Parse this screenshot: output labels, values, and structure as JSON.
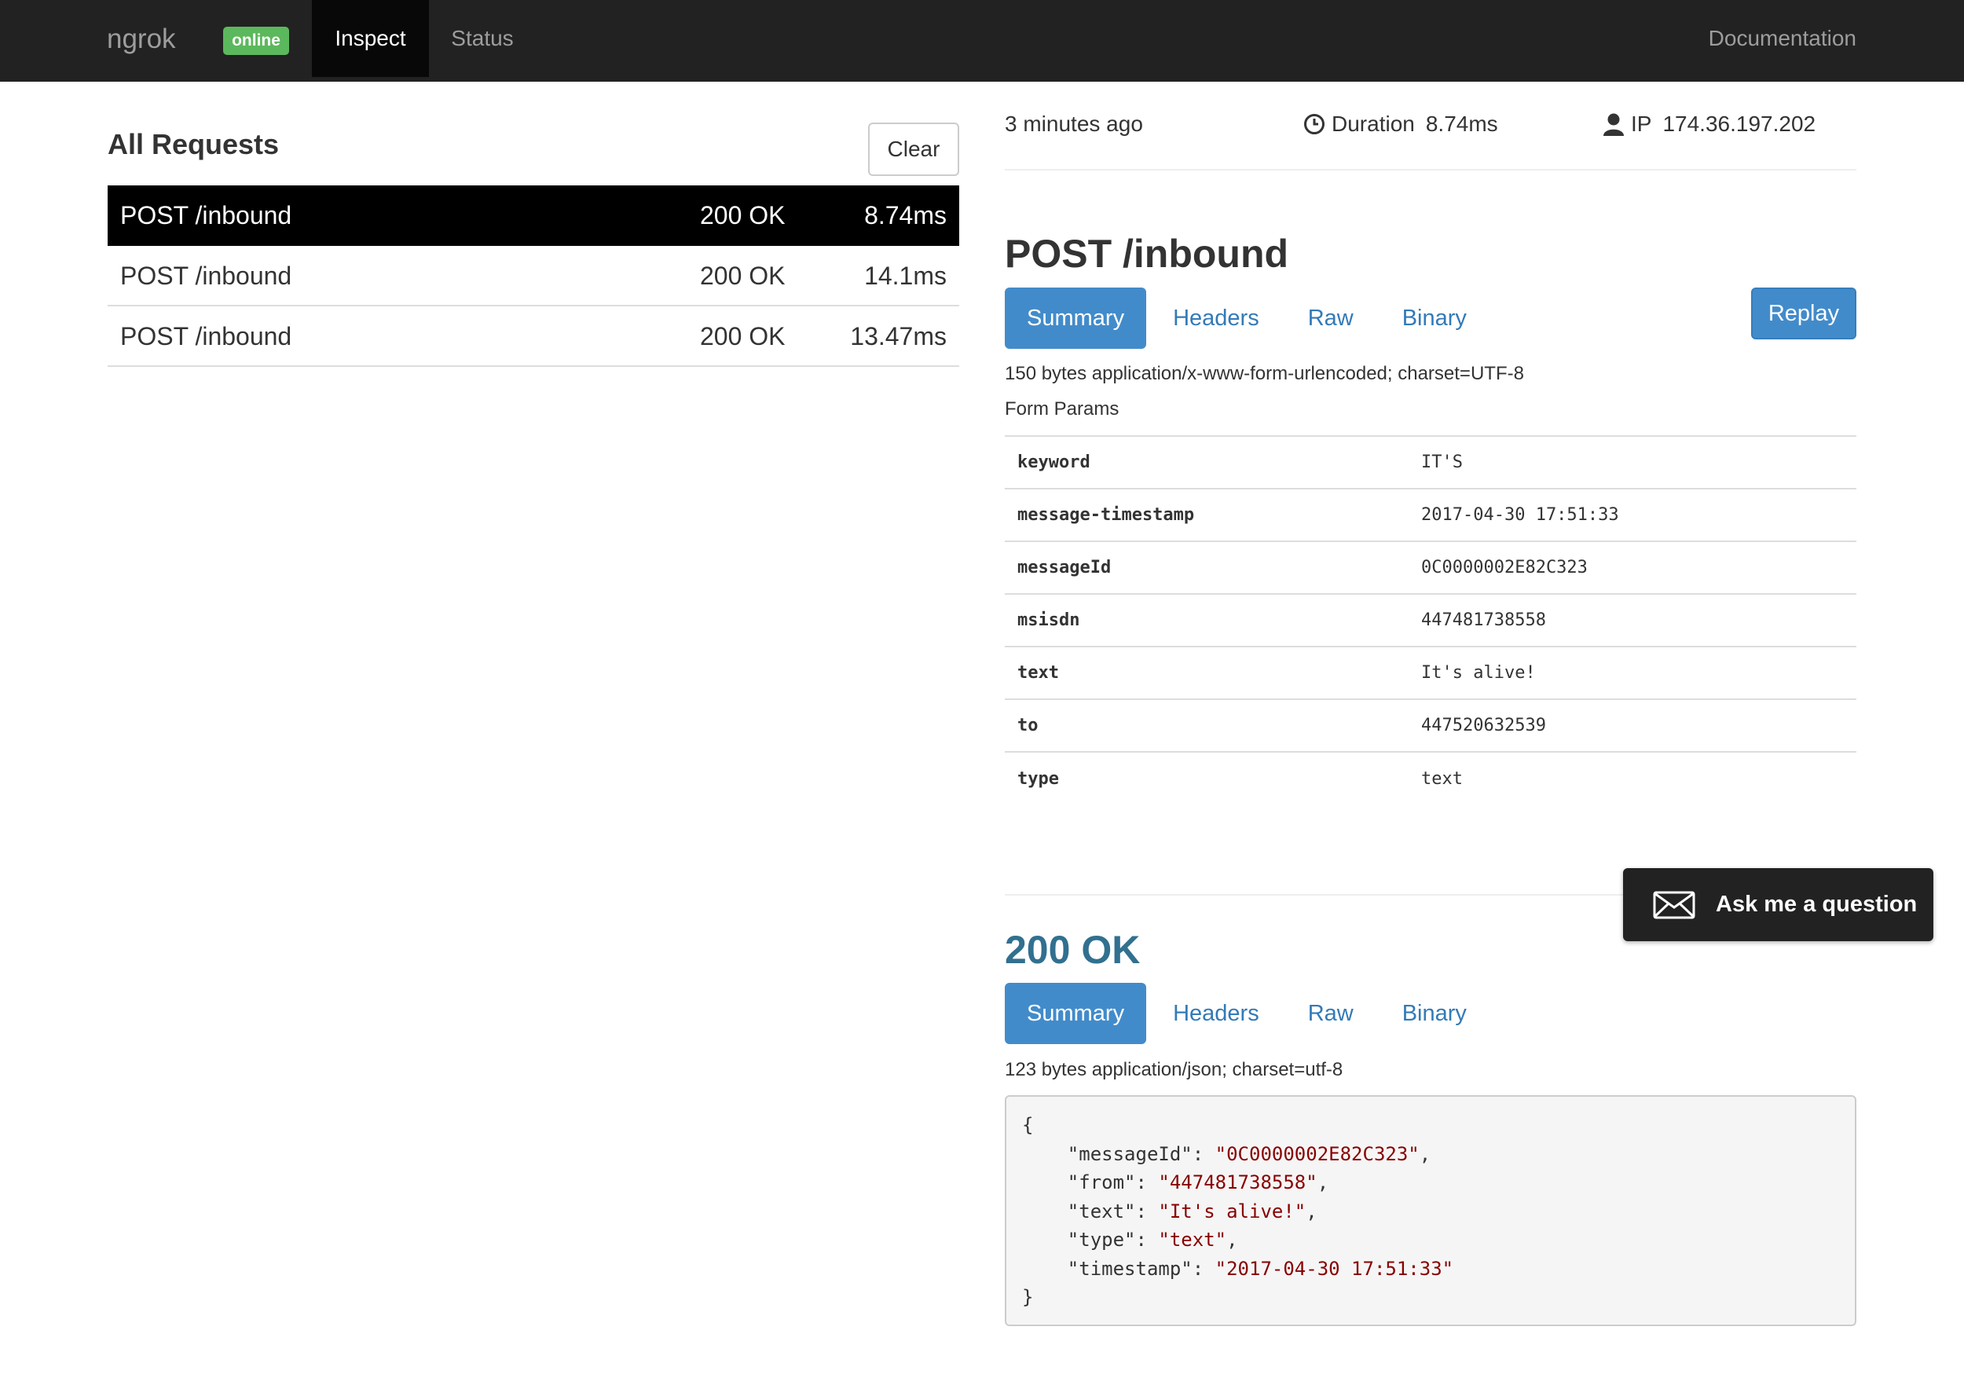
{
  "navbar": {
    "brand": "ngrok",
    "badge": "online",
    "tabs": [
      "Inspect",
      "Status"
    ],
    "active_tab": "Inspect",
    "docs_link": "Documentation"
  },
  "requests_panel": {
    "title": "All Requests",
    "clear_label": "Clear",
    "rows": [
      {
        "path": "POST /inbound",
        "status": "200 OK",
        "duration": "8.74ms",
        "selected": true
      },
      {
        "path": "POST /inbound",
        "status": "200 OK",
        "duration": "14.1ms",
        "selected": false
      },
      {
        "path": "POST /inbound",
        "status": "200 OK",
        "duration": "13.47ms",
        "selected": false
      }
    ]
  },
  "detail": {
    "time_ago": "3 minutes ago",
    "duration_label": "Duration",
    "duration": "8.74ms",
    "ip_label": "IP",
    "ip": "174.36.197.202",
    "icons": {
      "duration": "clock-icon",
      "ip": "user-icon"
    }
  },
  "request": {
    "title": "POST /inbound",
    "tabs": [
      "Summary",
      "Headers",
      "Raw",
      "Binary"
    ],
    "active_tab": "Summary",
    "replay_label": "Replay",
    "info": "150 bytes application/x-www-form-urlencoded; charset=UTF-8",
    "form_label": "Form Params",
    "params": [
      {
        "key": "keyword",
        "value": "IT'S"
      },
      {
        "key": "message-timestamp",
        "value": "2017-04-30 17:51:33"
      },
      {
        "key": "messageId",
        "value": "0C0000002E82C323"
      },
      {
        "key": "msisdn",
        "value": "447481738558"
      },
      {
        "key": "text",
        "value": "It's alive!"
      },
      {
        "key": "to",
        "value": "447520632539"
      },
      {
        "key": "type",
        "value": "text"
      }
    ]
  },
  "response": {
    "title": "200 OK",
    "tabs": [
      "Summary",
      "Headers",
      "Raw",
      "Binary"
    ],
    "active_tab": "Summary",
    "info": "123 bytes application/json; charset=utf-8",
    "json_open": "{",
    "json_close": "}",
    "json_fields": [
      {
        "key": "\"messageId\"",
        "value": "\"0C0000002E82C323\""
      },
      {
        "key": "\"from\"",
        "value": "\"447481738558\""
      },
      {
        "key": "\"text\"",
        "value": "\"It's alive!\""
      },
      {
        "key": "\"type\"",
        "value": "\"text\""
      },
      {
        "key": "\"timestamp\"",
        "value": "\"2017-04-30 17:51:33\""
      }
    ]
  },
  "ask_widget": {
    "label": "Ask me a question",
    "icon": "envelope-icon"
  },
  "colors": {
    "navbar_bg": "#222222",
    "online_badge": "#5cb85c",
    "primary": "#428bca",
    "link": "#337ab7",
    "response_title": "#31708f",
    "json_string": "#880000"
  }
}
